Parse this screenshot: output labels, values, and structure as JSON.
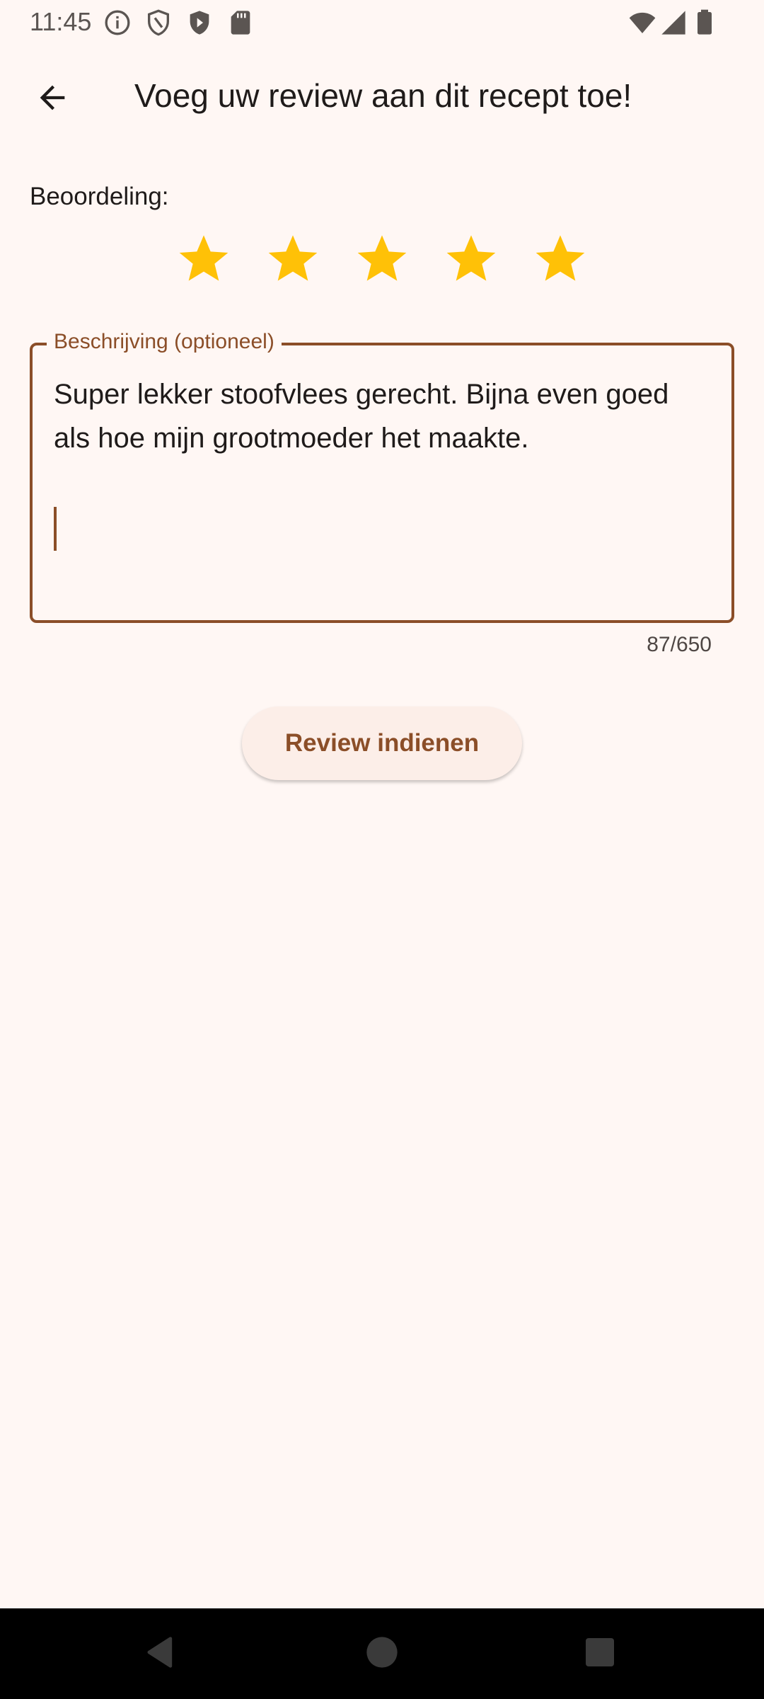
{
  "status_bar": {
    "time": "11:45",
    "left_icons": [
      "info-icon",
      "shield-outline-icon",
      "play-shield-icon",
      "sd-card-icon"
    ],
    "right_icons": [
      "wifi-icon",
      "signal-icon",
      "battery-icon"
    ]
  },
  "app_bar": {
    "back_icon": "arrow-back-icon",
    "title": "Voeg uw review aan dit recept toe!"
  },
  "rating": {
    "label": "Beoordeling:",
    "value": 5,
    "max": 5,
    "star_color": "#FFC107"
  },
  "description": {
    "label": "Beschrijving (optioneel)",
    "value": "Super lekker stoofvlees gerecht. Bijna even goed als hoe mijn grootmoeder het maakte.\n\n",
    "counter": "87/650"
  },
  "submit": {
    "label": "Review indienen"
  },
  "colors": {
    "background": "#FFF7F4",
    "accent": "#8B4E28",
    "button_bg": "#FCEEE8"
  },
  "nav_bar": {
    "buttons": [
      "back-triangle-icon",
      "home-circle-icon",
      "recents-square-icon"
    ]
  }
}
